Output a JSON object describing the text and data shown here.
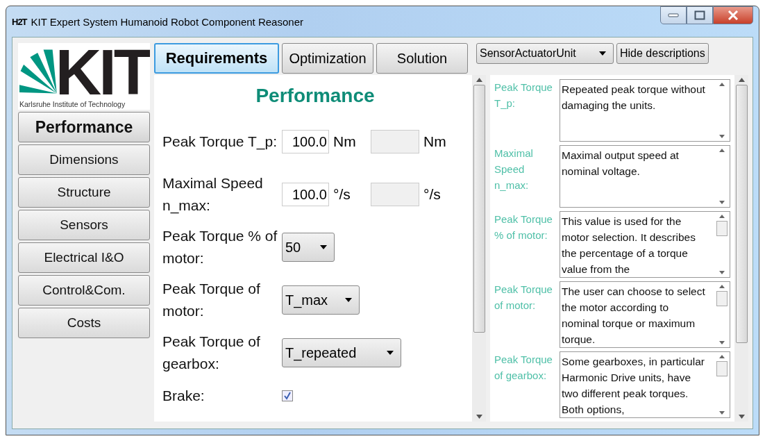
{
  "window": {
    "app_icon": "H2T",
    "title": "KIT Expert System Humanoid Robot Component Reasoner"
  },
  "logo": {
    "mark": "KIT",
    "caption": "Karlsruhe Institute of Technology"
  },
  "sidebar": {
    "items": [
      {
        "label": "Performance",
        "selected": true
      },
      {
        "label": "Dimensions",
        "selected": false
      },
      {
        "label": "Structure",
        "selected": false
      },
      {
        "label": "Sensors",
        "selected": false
      },
      {
        "label": "Electrical I&O",
        "selected": false
      },
      {
        "label": "Control&Com.",
        "selected": false
      },
      {
        "label": "Costs",
        "selected": false
      }
    ]
  },
  "tabs": [
    {
      "label": "Requirements",
      "selected": true
    },
    {
      "label": "Optimization",
      "selected": false
    },
    {
      "label": "Solution",
      "selected": false
    }
  ],
  "component_select": {
    "value": "SensorActuatorUnit"
  },
  "hide_button": "Hide descriptions",
  "form": {
    "title": "Performance",
    "rows": [
      {
        "kind": "number",
        "label": "Peak Torque T_p:",
        "value": "100.0",
        "unit": "Nm",
        "unit_2": "Nm"
      },
      {
        "kind": "number",
        "label": "Maximal Speed n_max:",
        "value": "100.0",
        "unit": "°/s",
        "unit_2": "°/s"
      },
      {
        "kind": "select",
        "label": "Peak Torque % of motor:",
        "value": "50"
      },
      {
        "kind": "select",
        "label": "Peak Torque of motor:",
        "value": "T_max"
      },
      {
        "kind": "select",
        "label": "Peak Torque of gearbox:",
        "value": "T_repeated"
      },
      {
        "kind": "checkbox",
        "label": "Brake:",
        "checked": true
      }
    ]
  },
  "descriptions": [
    {
      "label": "Peak Torque T_p:",
      "text": "Repeated peak torque without damaging the units.",
      "thumb": false
    },
    {
      "label": "Maximal Speed n_max:",
      "text": "Maximal output speed at nominal voltage.",
      "thumb": false
    },
    {
      "label": "Peak Torque % of motor:",
      "text": "This value is used for the motor selection. It describes the percentage of a torque value from the",
      "thumb": true
    },
    {
      "label": "Peak Torque of motor:",
      "text": "The user can choose to select the motor according to nominal torque or maximum torque.",
      "thumb": true
    },
    {
      "label": "Peak Torque of gearbox:",
      "text": "Some gearboxes, in particular Harmonic Drive units, have two different peak torques. Both options,",
      "thumb": true
    }
  ]
}
